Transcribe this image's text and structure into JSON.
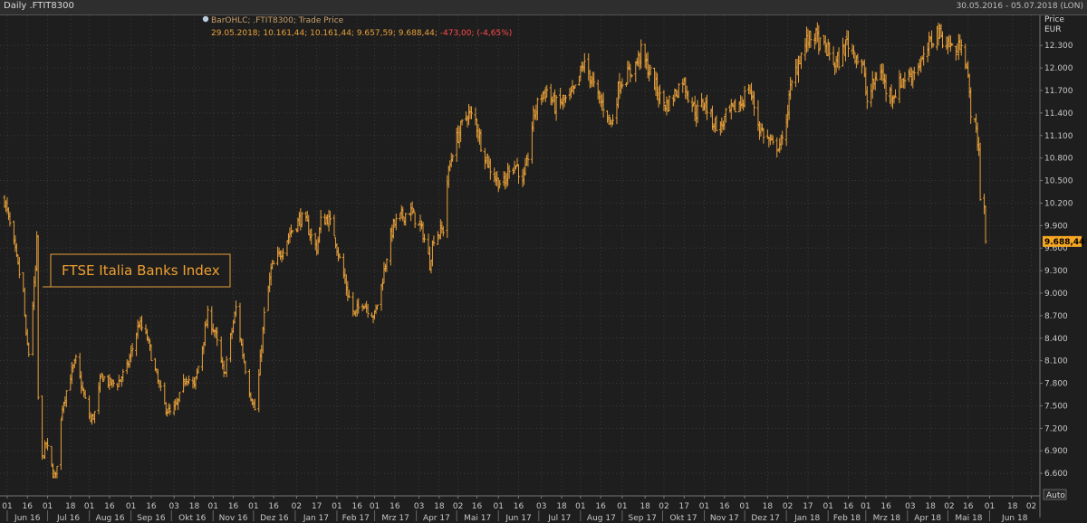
{
  "header": {
    "title": "Daily .FTIT8300",
    "date_range": "30.05.2016 - 05.07.2018 (LON)"
  },
  "legend": {
    "line1": "BarOHLC; .FTIT8300; Trade Price",
    "line2": "29.05.2018; 10.161,44; 10.161,44; 9.657,59; 9.688,44; ",
    "change": "-473,00; (-4,65%)"
  },
  "annotation": "FTSE Italia Banks Index",
  "last_value_label": "9.688,44",
  "auto_label": "Auto",
  "colors": {
    "background": "#1e1e1e",
    "bar": "#e8a03a",
    "grid": "#3a3a3a",
    "last_value_bg": "#f5a623",
    "negative": "#ff4a4a"
  },
  "chart_data": {
    "type": "bar",
    "subtype": "ohlc",
    "instrument": ".FTIT8300",
    "yaxis": {
      "title": "Price",
      "unit": "EUR",
      "ylim": [
        6300,
        12700
      ],
      "ticks": [
        6600,
        6900,
        7200,
        7500,
        7800,
        8100,
        8400,
        8700,
        9000,
        9300,
        9600,
        9900,
        10200,
        10500,
        10800,
        11100,
        11400,
        11700,
        12000,
        12300
      ],
      "tick_labels": [
        "6.600",
        "6.900",
        "7.200",
        "7.500",
        "7.800",
        "8.100",
        "8.400",
        "8.700",
        "9.000",
        "9.300",
        "9.600",
        "9.900",
        "10.200",
        "10.500",
        "10.800",
        "11.100",
        "11.400",
        "11.700",
        "12.000",
        "12.300"
      ]
    },
    "xaxis": {
      "start": "2016-05-30",
      "end": "2018-07-05",
      "ticks": [
        {
          "date": "2016-06-01",
          "label": "01"
        },
        {
          "date": "2016-06-16",
          "label": "16"
        },
        {
          "date": "2016-07-01",
          "label": "01"
        },
        {
          "date": "2016-07-18",
          "label": "18"
        },
        {
          "date": "2016-08-01",
          "label": "01"
        },
        {
          "date": "2016-08-16",
          "label": "16"
        },
        {
          "date": "2016-09-01",
          "label": "01"
        },
        {
          "date": "2016-09-16",
          "label": "16"
        },
        {
          "date": "2016-10-03",
          "label": "03"
        },
        {
          "date": "2016-10-18",
          "label": "18"
        },
        {
          "date": "2016-11-01",
          "label": "01"
        },
        {
          "date": "2016-11-16",
          "label": "16"
        },
        {
          "date": "2016-12-01",
          "label": "01"
        },
        {
          "date": "2016-12-16",
          "label": "16"
        },
        {
          "date": "2017-01-02",
          "label": "02"
        },
        {
          "date": "2017-01-17",
          "label": "17"
        },
        {
          "date": "2017-02-01",
          "label": "01"
        },
        {
          "date": "2017-02-16",
          "label": "16"
        },
        {
          "date": "2017-03-01",
          "label": "01"
        },
        {
          "date": "2017-03-16",
          "label": "16"
        },
        {
          "date": "2017-04-03",
          "label": "03"
        },
        {
          "date": "2017-04-18",
          "label": "18"
        },
        {
          "date": "2017-05-02",
          "label": "02"
        },
        {
          "date": "2017-05-16",
          "label": "16"
        },
        {
          "date": "2017-06-01",
          "label": "01"
        },
        {
          "date": "2017-06-16",
          "label": "16"
        },
        {
          "date": "2017-07-03",
          "label": "03"
        },
        {
          "date": "2017-07-18",
          "label": "18"
        },
        {
          "date": "2017-08-01",
          "label": "01"
        },
        {
          "date": "2017-08-16",
          "label": "16"
        },
        {
          "date": "2017-09-01",
          "label": "01"
        },
        {
          "date": "2017-09-18",
          "label": "18"
        },
        {
          "date": "2017-10-02",
          "label": "02"
        },
        {
          "date": "2017-10-17",
          "label": "17"
        },
        {
          "date": "2017-11-01",
          "label": "01"
        },
        {
          "date": "2017-11-16",
          "label": "16"
        },
        {
          "date": "2017-12-01",
          "label": "01"
        },
        {
          "date": "2017-12-18",
          "label": "18"
        },
        {
          "date": "2018-01-02",
          "label": "02"
        },
        {
          "date": "2018-01-17",
          "label": "17"
        },
        {
          "date": "2018-02-01",
          "label": "01"
        },
        {
          "date": "2018-02-16",
          "label": "16"
        },
        {
          "date": "2018-03-01",
          "label": "01"
        },
        {
          "date": "2018-03-16",
          "label": "16"
        },
        {
          "date": "2018-04-03",
          "label": "03"
        },
        {
          "date": "2018-04-18",
          "label": "18"
        },
        {
          "date": "2018-05-02",
          "label": "02"
        },
        {
          "date": "2018-05-16",
          "label": "16"
        },
        {
          "date": "2018-06-01",
          "label": "01"
        },
        {
          "date": "2018-06-18",
          "label": "18"
        },
        {
          "date": "2018-07-02",
          "label": "02"
        }
      ],
      "months": [
        {
          "date": "2016-06-01",
          "label": "Jun 16"
        },
        {
          "date": "2016-07-01",
          "label": "Jul 16"
        },
        {
          "date": "2016-08-01",
          "label": "Aug 16"
        },
        {
          "date": "2016-09-01",
          "label": "Sep 16"
        },
        {
          "date": "2016-10-01",
          "label": "Okt 16"
        },
        {
          "date": "2016-11-01",
          "label": "Nov 16"
        },
        {
          "date": "2016-12-01",
          "label": "Dez 16"
        },
        {
          "date": "2017-01-01",
          "label": "Jan 17"
        },
        {
          "date": "2017-02-01",
          "label": "Feb 17"
        },
        {
          "date": "2017-03-01",
          "label": "Mrz 17"
        },
        {
          "date": "2017-04-01",
          "label": "Apr 17"
        },
        {
          "date": "2017-05-01",
          "label": "Mai 17"
        },
        {
          "date": "2017-06-01",
          "label": "Jun 17"
        },
        {
          "date": "2017-07-01",
          "label": "Jul 17"
        },
        {
          "date": "2017-08-01",
          "label": "Aug 17"
        },
        {
          "date": "2017-09-01",
          "label": "Sep 17"
        },
        {
          "date": "2017-10-01",
          "label": "Okt 17"
        },
        {
          "date": "2017-11-01",
          "label": "Nov 17"
        },
        {
          "date": "2017-12-01",
          "label": "Dez 17"
        },
        {
          "date": "2018-01-01",
          "label": "Jan 18"
        },
        {
          "date": "2018-02-01",
          "label": "Feb 18"
        },
        {
          "date": "2018-03-01",
          "label": "Mrz 18"
        },
        {
          "date": "2018-04-01",
          "label": "Apr 18"
        },
        {
          "date": "2018-05-01",
          "label": "Mai 18"
        },
        {
          "date": "2018-06-01",
          "label": "Jun 18"
        }
      ]
    },
    "close_path": [
      [
        "2016-05-30",
        10250
      ],
      [
        "2016-06-03",
        9900
      ],
      [
        "2016-06-09",
        9350
      ],
      [
        "2016-06-13",
        9000
      ],
      [
        "2016-06-15",
        8400
      ],
      [
        "2016-06-17",
        8200
      ],
      [
        "2016-06-22",
        9300
      ],
      [
        "2016-06-23",
        9680
      ],
      [
        "2016-06-24",
        7600
      ],
      [
        "2016-06-27",
        6800
      ],
      [
        "2016-06-30",
        7000
      ],
      [
        "2016-07-05",
        6600
      ],
      [
        "2016-07-07",
        6550
      ],
      [
        "2016-07-12",
        7500
      ],
      [
        "2016-07-18",
        7900
      ],
      [
        "2016-07-22",
        8100
      ],
      [
        "2016-07-27",
        7700
      ],
      [
        "2016-08-02",
        7300
      ],
      [
        "2016-08-05",
        7400
      ],
      [
        "2016-08-10",
        7900
      ],
      [
        "2016-08-16",
        7800
      ],
      [
        "2016-08-22",
        7800
      ],
      [
        "2016-08-29",
        8000
      ],
      [
        "2016-09-07",
        8600
      ],
      [
        "2016-09-13",
        8400
      ],
      [
        "2016-09-19",
        7950
      ],
      [
        "2016-09-26",
        7500
      ],
      [
        "2016-09-30",
        7400
      ],
      [
        "2016-10-05",
        7500
      ],
      [
        "2016-10-12",
        7900
      ],
      [
        "2016-10-18",
        7750
      ],
      [
        "2016-10-24",
        8300
      ],
      [
        "2016-10-28",
        8700
      ],
      [
        "2016-11-02",
        8500
      ],
      [
        "2016-11-09",
        7900
      ],
      [
        "2016-11-14",
        8400
      ],
      [
        "2016-11-18",
        8800
      ],
      [
        "2016-11-22",
        8300
      ],
      [
        "2016-11-28",
        7700
      ],
      [
        "2016-12-02",
        7450
      ],
      [
        "2016-12-05",
        7900
      ],
      [
        "2016-12-09",
        8700
      ],
      [
        "2016-12-14",
        9300
      ],
      [
        "2016-12-20",
        9500
      ],
      [
        "2016-12-28",
        9800
      ],
      [
        "2017-01-05",
        10000
      ],
      [
        "2017-01-10",
        9900
      ],
      [
        "2017-01-13",
        9750
      ],
      [
        "2017-01-17",
        9600
      ],
      [
        "2017-01-20",
        9950
      ],
      [
        "2017-01-25",
        10000
      ],
      [
        "2017-01-30",
        9800
      ],
      [
        "2017-02-03",
        9450
      ],
      [
        "2017-02-09",
        9000
      ],
      [
        "2017-02-14",
        8700
      ],
      [
        "2017-02-20",
        8900
      ],
      [
        "2017-02-24",
        8800
      ],
      [
        "2017-03-01",
        8700
      ],
      [
        "2017-03-06",
        9100
      ],
      [
        "2017-03-10",
        9500
      ],
      [
        "2017-03-15",
        9900
      ],
      [
        "2017-03-20",
        10000
      ],
      [
        "2017-03-27",
        10100
      ],
      [
        "2017-03-31",
        10000
      ],
      [
        "2017-04-06",
        9800
      ],
      [
        "2017-04-11",
        9400
      ],
      [
        "2017-04-14",
        9750
      ],
      [
        "2017-04-21",
        9850
      ],
      [
        "2017-04-24",
        10500
      ],
      [
        "2017-04-28",
        10900
      ],
      [
        "2017-05-03",
        11150
      ],
      [
        "2017-05-09",
        11400
      ],
      [
        "2017-05-15",
        11300
      ],
      [
        "2017-05-19",
        11000
      ],
      [
        "2017-05-25",
        10700
      ],
      [
        "2017-05-31",
        10500
      ],
      [
        "2017-06-06",
        10450
      ],
      [
        "2017-06-09",
        10700
      ],
      [
        "2017-06-15",
        10700
      ],
      [
        "2017-06-19",
        10450
      ],
      [
        "2017-06-22",
        10700
      ],
      [
        "2017-06-27",
        11350
      ],
      [
        "2017-07-03",
        11650
      ],
      [
        "2017-07-07",
        11700
      ],
      [
        "2017-07-13",
        11500
      ],
      [
        "2017-07-19",
        11550
      ],
      [
        "2017-07-24",
        11600
      ],
      [
        "2017-07-28",
        11700
      ],
      [
        "2017-08-03",
        12050
      ],
      [
        "2017-08-08",
        11900
      ],
      [
        "2017-08-14",
        11600
      ],
      [
        "2017-08-18",
        11500
      ],
      [
        "2017-08-24",
        11250
      ],
      [
        "2017-08-30",
        11800
      ],
      [
        "2017-09-05",
        11900
      ],
      [
        "2017-09-11",
        12050
      ],
      [
        "2017-09-15",
        12200
      ],
      [
        "2017-09-20",
        12000
      ],
      [
        "2017-09-26",
        11750
      ],
      [
        "2017-09-29",
        11600
      ],
      [
        "2017-10-04",
        11500
      ],
      [
        "2017-10-10",
        11650
      ],
      [
        "2017-10-16",
        11850
      ],
      [
        "2017-10-20",
        11650
      ],
      [
        "2017-10-26",
        11400
      ],
      [
        "2017-11-01",
        11550
      ],
      [
        "2017-11-07",
        11300
      ],
      [
        "2017-11-13",
        11200
      ],
      [
        "2017-11-17",
        11350
      ],
      [
        "2017-11-23",
        11450
      ],
      [
        "2017-11-29",
        11550
      ],
      [
        "2017-12-04",
        11750
      ],
      [
        "2017-12-08",
        11500
      ],
      [
        "2017-12-12",
        11200
      ],
      [
        "2017-12-18",
        11050
      ],
      [
        "2017-12-22",
        10950
      ],
      [
        "2017-12-29",
        11000
      ],
      [
        "2018-01-04",
        11700
      ],
      [
        "2018-01-10",
        12100
      ],
      [
        "2018-01-16",
        12350
      ],
      [
        "2018-01-22",
        12450
      ],
      [
        "2018-01-26",
        12300
      ],
      [
        "2018-01-31",
        12250
      ],
      [
        "2018-02-06",
        12050
      ],
      [
        "2018-02-09",
        12100
      ],
      [
        "2018-02-15",
        12350
      ],
      [
        "2018-02-21",
        12200
      ],
      [
        "2018-02-27",
        12000
      ],
      [
        "2018-03-02",
        11550
      ],
      [
        "2018-03-07",
        11800
      ],
      [
        "2018-03-12",
        12000
      ],
      [
        "2018-03-16",
        11700
      ],
      [
        "2018-03-22",
        11650
      ],
      [
        "2018-03-28",
        11850
      ],
      [
        "2018-04-03",
        11900
      ],
      [
        "2018-04-09",
        12050
      ],
      [
        "2018-04-13",
        12100
      ],
      [
        "2018-04-17",
        12300
      ],
      [
        "2018-04-23",
        12500
      ],
      [
        "2018-04-27",
        12400
      ],
      [
        "2018-05-03",
        12300
      ],
      [
        "2018-05-08",
        12200
      ],
      [
        "2018-05-11",
        12400
      ],
      [
        "2018-05-15",
        12000
      ],
      [
        "2018-05-18",
        11450
      ],
      [
        "2018-05-22",
        11150
      ],
      [
        "2018-05-24",
        10900
      ],
      [
        "2018-05-25",
        10300
      ],
      [
        "2018-05-28",
        10161.44
      ],
      [
        "2018-05-29",
        9688.44
      ]
    ],
    "last_bar": {
      "date": "2018-05-29",
      "open": 10161.44,
      "high": 10161.44,
      "low": 9657.59,
      "close": 9688.44,
      "change": -473.0,
      "change_pct": -4.65
    }
  }
}
